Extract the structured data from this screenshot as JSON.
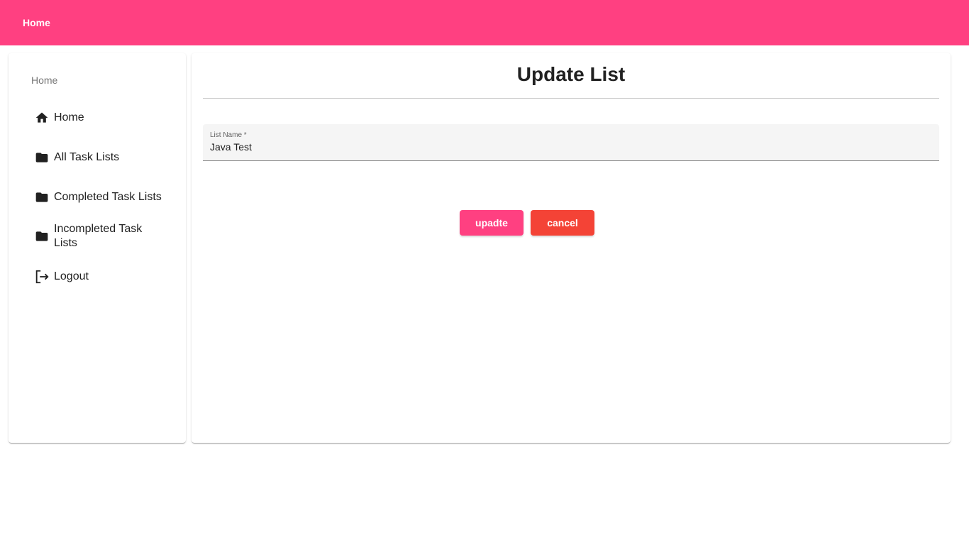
{
  "topbar": {
    "home_link": "Home"
  },
  "sidebar": {
    "header": "Home",
    "items": [
      {
        "label": "Home",
        "icon": "home-icon"
      },
      {
        "label": "All Task Lists",
        "icon": "folder-icon"
      },
      {
        "label": "Completed Task Lists",
        "icon": "folder-icon"
      },
      {
        "label": "Incompleted Task Lists",
        "icon": "folder-icon"
      },
      {
        "label": "Logout",
        "icon": "logout-icon"
      }
    ]
  },
  "main": {
    "title": "Update List",
    "list_name_field": {
      "label": "List Name *",
      "value": "Java Test"
    },
    "update_button": "upadte",
    "cancel_button": "cancel"
  },
  "colors": {
    "accent": "#ff4081",
    "warn": "#f44336"
  }
}
